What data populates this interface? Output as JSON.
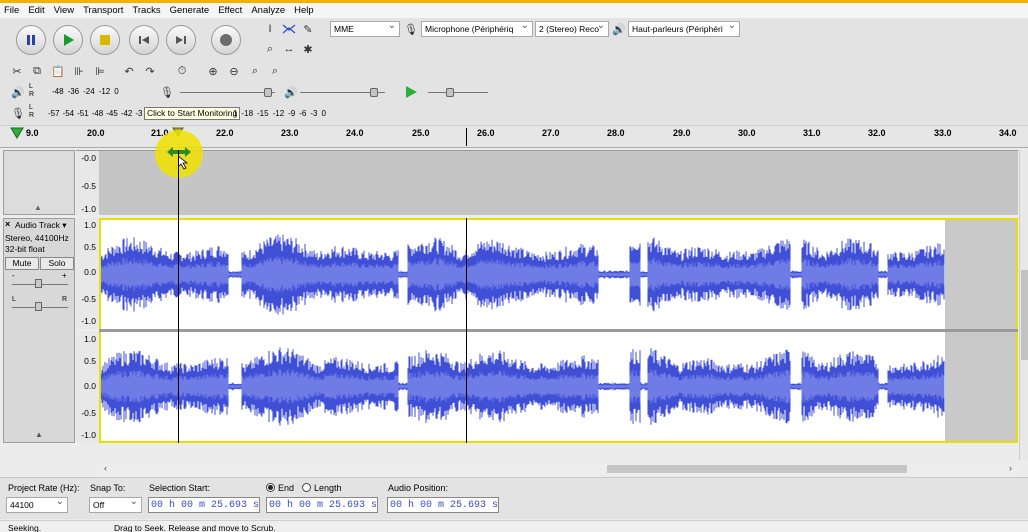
{
  "menu": [
    "File",
    "Edit",
    "View",
    "Transport",
    "Tracks",
    "Generate",
    "Effect",
    "Analyze",
    "Help"
  ],
  "device": {
    "host": "MME",
    "input": "Microphone (Périphériq",
    "channels": "2 (Stereo) Reco",
    "output": "Haut-parleurs (Périphéri"
  },
  "meters": {
    "playback_scale": [
      "-48",
      "-36",
      "-24",
      "-12",
      "0"
    ],
    "record_scale": [
      "-57",
      "-54",
      "-51",
      "-48",
      "-45",
      "-42",
      "-3"
    ],
    "record_scale_right": [
      "1",
      "-18",
      "-15",
      "-12",
      "-9",
      "-6",
      "-3",
      "0"
    ],
    "tooltip": "Click to Start Monitoring",
    "lr": [
      "L",
      "R"
    ]
  },
  "ruler": {
    "ticks": [
      "9.0",
      "20.0",
      "21.0",
      "22.0",
      "23.0",
      "24.0",
      "25.0",
      "26.0",
      "27.0",
      "28.0",
      "29.0",
      "30.0",
      "31.0",
      "32.0",
      "33.0",
      "34.0"
    ]
  },
  "scale_top": [
    "-0.0",
    "-0.5",
    "-1.0"
  ],
  "scale_full": [
    "1.0",
    "0.5",
    "0.0",
    "-0.5",
    "-1.0"
  ],
  "track": {
    "name": "Audio Track",
    "info1": "Stereo, 44100Hz",
    "info2": "32-bit float",
    "mute": "Mute",
    "solo": "Solo",
    "gain_minus": "-",
    "gain_plus": "+",
    "pan_l": "L",
    "pan_r": "R"
  },
  "bottom": {
    "project_rate_label": "Project Rate (Hz):",
    "project_rate": "44100",
    "snap_label": "Snap To:",
    "snap_value": "Off",
    "selection_start_label": "Selection Start:",
    "end_label": "End",
    "length_label": "Length",
    "audio_position_label": "Audio Position:",
    "selection_start": "00 h 00 m 25.693 s",
    "selection_end": "00 h 00 m 25.693 s",
    "audio_position": "00 h 00 m 25.693 s"
  },
  "status": {
    "left": "Seeking.",
    "right": "Drag to Seek. Release and move to Scrub."
  },
  "colors": {
    "wave": "#3f4fd6",
    "wave_light": "#6f7ce6",
    "track_bg": "#c9c9c9",
    "highlight": "#f0e000"
  }
}
